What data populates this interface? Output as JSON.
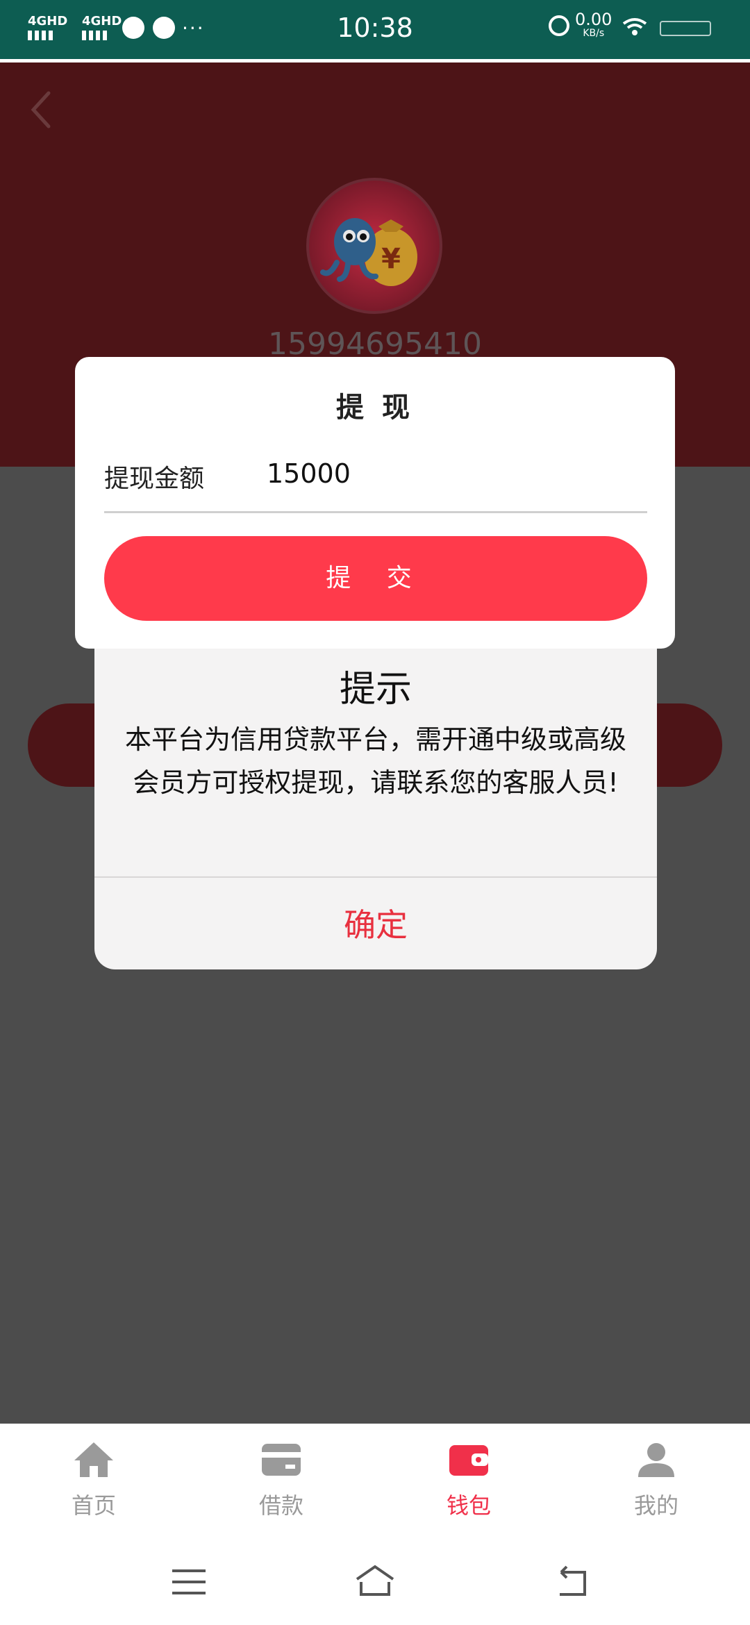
{
  "status_bar": {
    "time": "10:38",
    "sim1": "4GHD",
    "sim2": "4GHD",
    "speed_value": "0.00",
    "speed_unit": "KB/s",
    "icons": [
      "signal-icon",
      "signal-icon",
      "speedometer-icon",
      "check-circle-icon",
      "more-dots-icon",
      "alarm-icon",
      "wifi-icon",
      "battery-icon"
    ]
  },
  "profile": {
    "phone": "15994695410"
  },
  "withdraw_dialog": {
    "title": "提 现",
    "amount_label": "提现金额",
    "amount_value": "15000",
    "submit_label": "提 交"
  },
  "alert_dialog": {
    "title": "提示",
    "message": "本平台为信用贷款平台，需开通中级或高级会员方可授权提现，请联系您的客服人员!",
    "ok_label": "确定"
  },
  "tabs": [
    {
      "label": "首页",
      "icon": "home-icon",
      "active": false
    },
    {
      "label": "借款",
      "icon": "card-icon",
      "active": false
    },
    {
      "label": "钱包",
      "icon": "wallet-icon",
      "active": true
    },
    {
      "label": "我的",
      "icon": "user-icon",
      "active": false
    }
  ],
  "colors": {
    "accent": "#ff3a4b",
    "status_bar": "#0d5d52",
    "header": "#4d1417",
    "tab_active": "#f0304a",
    "tab_inactive": "#9a9a9a"
  }
}
